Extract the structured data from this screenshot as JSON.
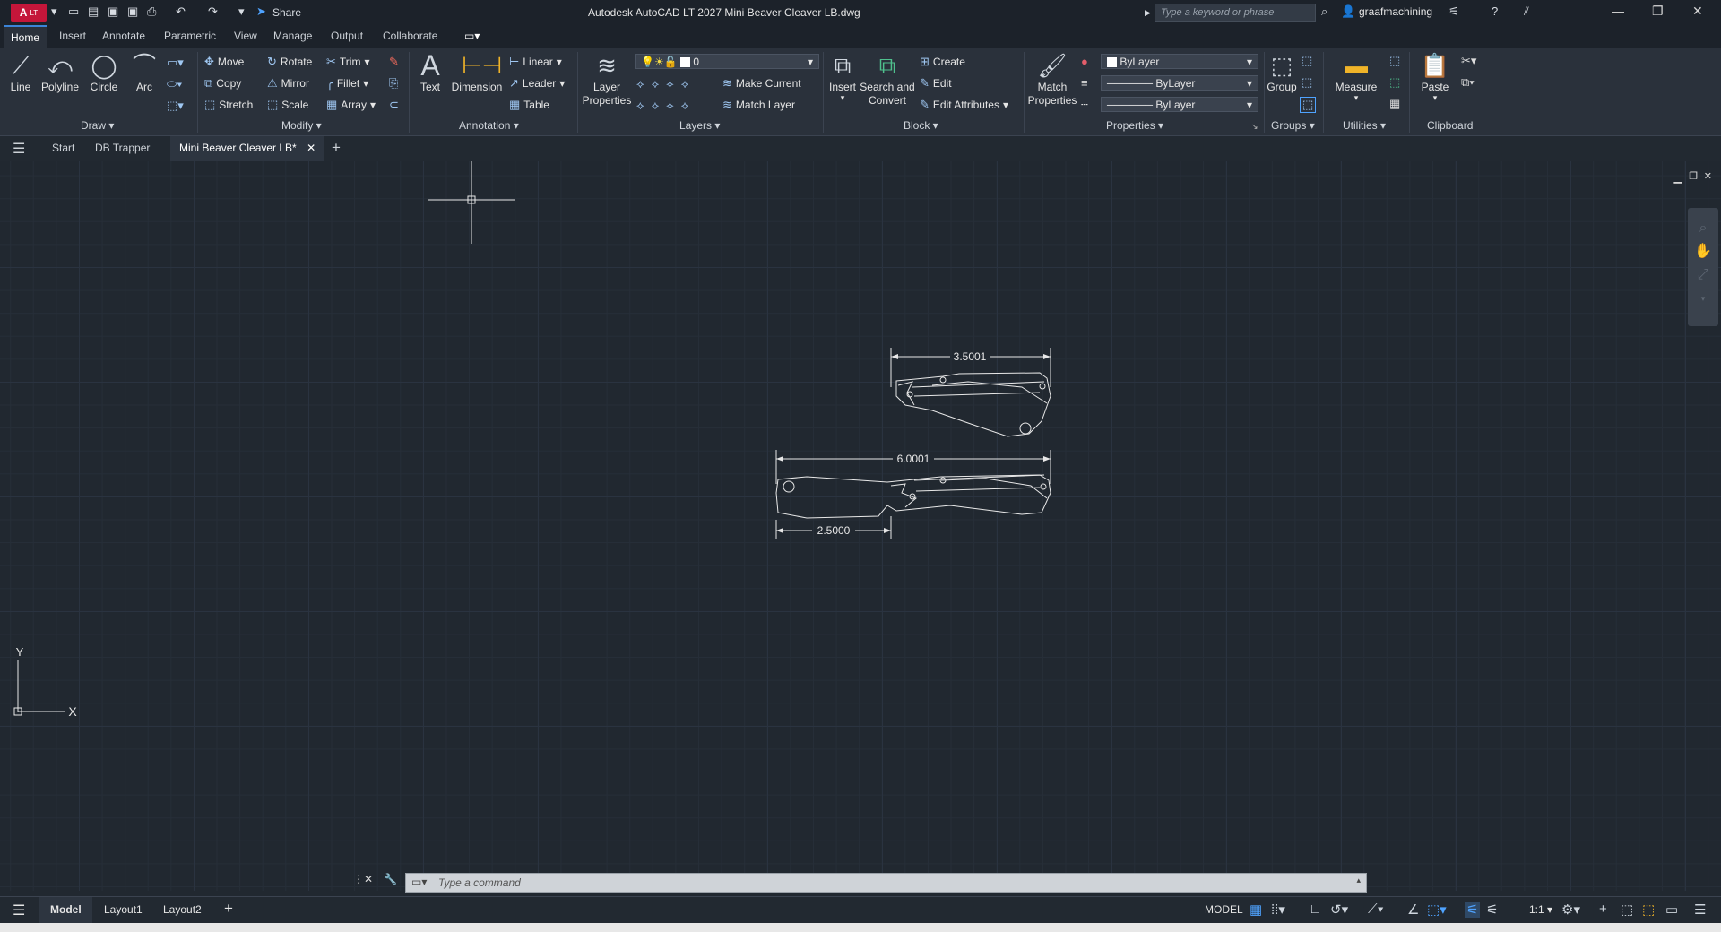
{
  "titlebar": {
    "app_abbrev": "A",
    "app_tag": "LT",
    "share": "Share",
    "title": "Autodesk AutoCAD LT 2027   Mini Beaver Cleaver LB.dwg",
    "search_placeholder": "Type a keyword or phrase",
    "user": "graafmachining"
  },
  "ribbon_tabs": [
    "Home",
    "Insert",
    "Annotate",
    "Parametric",
    "View",
    "Manage",
    "Output",
    "Collaborate"
  ],
  "draw": {
    "line": "Line",
    "polyline": "Polyline",
    "circle": "Circle",
    "arc": "Arc",
    "label": "Draw"
  },
  "modify": {
    "move": "Move",
    "rotate": "Rotate",
    "trim": "Trim",
    "copy": "Copy",
    "mirror": "Mirror",
    "fillet": "Fillet",
    "stretch": "Stretch",
    "scale": "Scale",
    "array": "Array",
    "label": "Modify"
  },
  "annotation": {
    "text": "Text",
    "dimension": "Dimension",
    "linear": "Linear",
    "leader": "Leader",
    "table": "Table",
    "label": "Annotation"
  },
  "layers": {
    "layer_properties": "Layer\nProperties",
    "layer_value": "0",
    "make_current": "Make Current",
    "match_layer": "Match Layer",
    "label": "Layers"
  },
  "block": {
    "insert": "Insert",
    "search_convert": "Search and\nConvert",
    "create": "Create",
    "edit": "Edit",
    "edit_attributes": "Edit Attributes",
    "label": "Block"
  },
  "properties": {
    "match": "Match\nProperties",
    "color": "ByLayer",
    "linetype": "ByLayer",
    "lineweight": "ByLayer",
    "label": "Properties"
  },
  "groups": {
    "group": "Group",
    "label": "Groups"
  },
  "utilities": {
    "measure": "Measure",
    "label": "Utilities"
  },
  "clipboard": {
    "paste": "Paste",
    "label": "Clipboard"
  },
  "file_tabs": {
    "start": "Start",
    "db_trapper": "DB Trapper",
    "active": "Mini Beaver Cleaver LB*"
  },
  "drawing": {
    "dim_top": "3.5001",
    "dim_mid": "6.0001",
    "dim_bottom": "2.5000",
    "ucs_y": "Y",
    "ucs_x": "X"
  },
  "command": {
    "placeholder": "Type a command"
  },
  "status": {
    "model_tab": "Model",
    "layout1": "Layout1",
    "layout2": "Layout2",
    "model_label": "MODEL",
    "scale": "1:1"
  }
}
